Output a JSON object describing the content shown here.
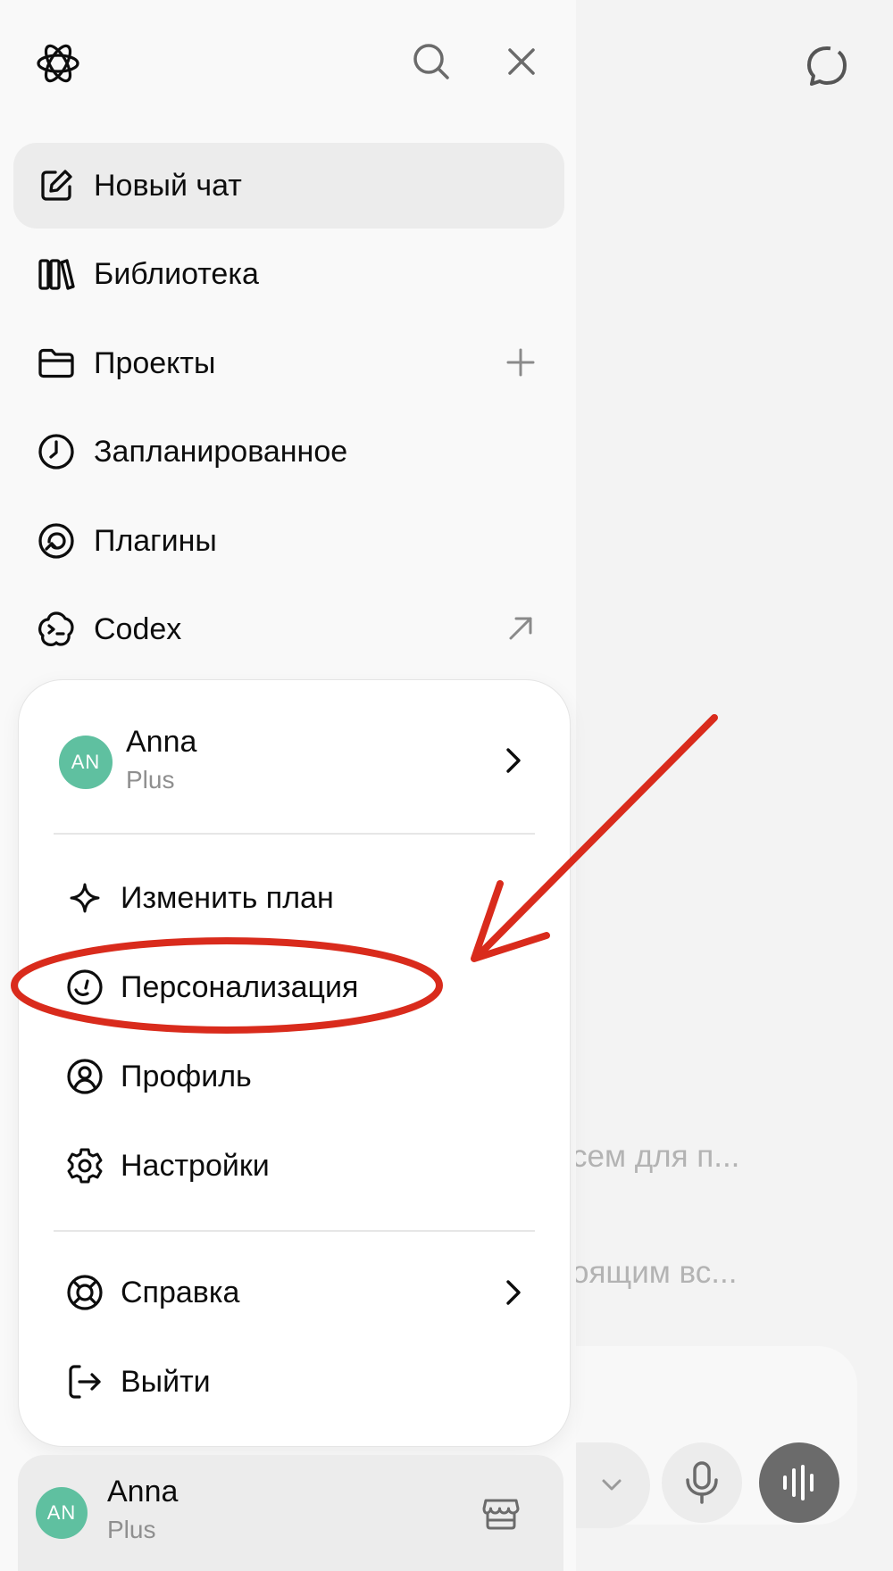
{
  "background": {
    "snippet_1": "сем для п...",
    "snippet_2": "оящим вс..."
  },
  "sidebar": {
    "nav": [
      {
        "label": "Новый чат",
        "icon": "edit-icon",
        "active": true
      },
      {
        "label": "Библиотека",
        "icon": "library-icon"
      },
      {
        "label": "Проекты",
        "icon": "folder-icon",
        "trailing": "plus-icon"
      },
      {
        "label": "Запланированное",
        "icon": "clock-icon"
      },
      {
        "label": "Плагины",
        "icon": "plugins-icon"
      },
      {
        "label": "Codex",
        "icon": "codex-icon",
        "trailing": "external-arrow-icon"
      }
    ]
  },
  "account_menu": {
    "user": {
      "initials": "AN",
      "name": "Anna",
      "plan": "Plus"
    },
    "items": [
      {
        "label": "Изменить план",
        "icon": "sparkle-icon"
      },
      {
        "label": "Персонализация",
        "icon": "personalization-icon",
        "highlighted": true
      },
      {
        "label": "Профиль",
        "icon": "profile-icon"
      },
      {
        "label": "Настройки",
        "icon": "gear-icon"
      },
      {
        "label": "Справка",
        "icon": "help-lifebuoy-icon",
        "trailing": "chevron-right-icon"
      },
      {
        "label": "Выйти",
        "icon": "logout-icon"
      }
    ]
  },
  "bottom_user": {
    "initials": "AN",
    "name": "Anna",
    "plan": "Plus"
  },
  "annotation": {
    "color": "#d92b1c"
  },
  "colors": {
    "avatar": "#5fc0a0",
    "active_item": "#ececec"
  }
}
